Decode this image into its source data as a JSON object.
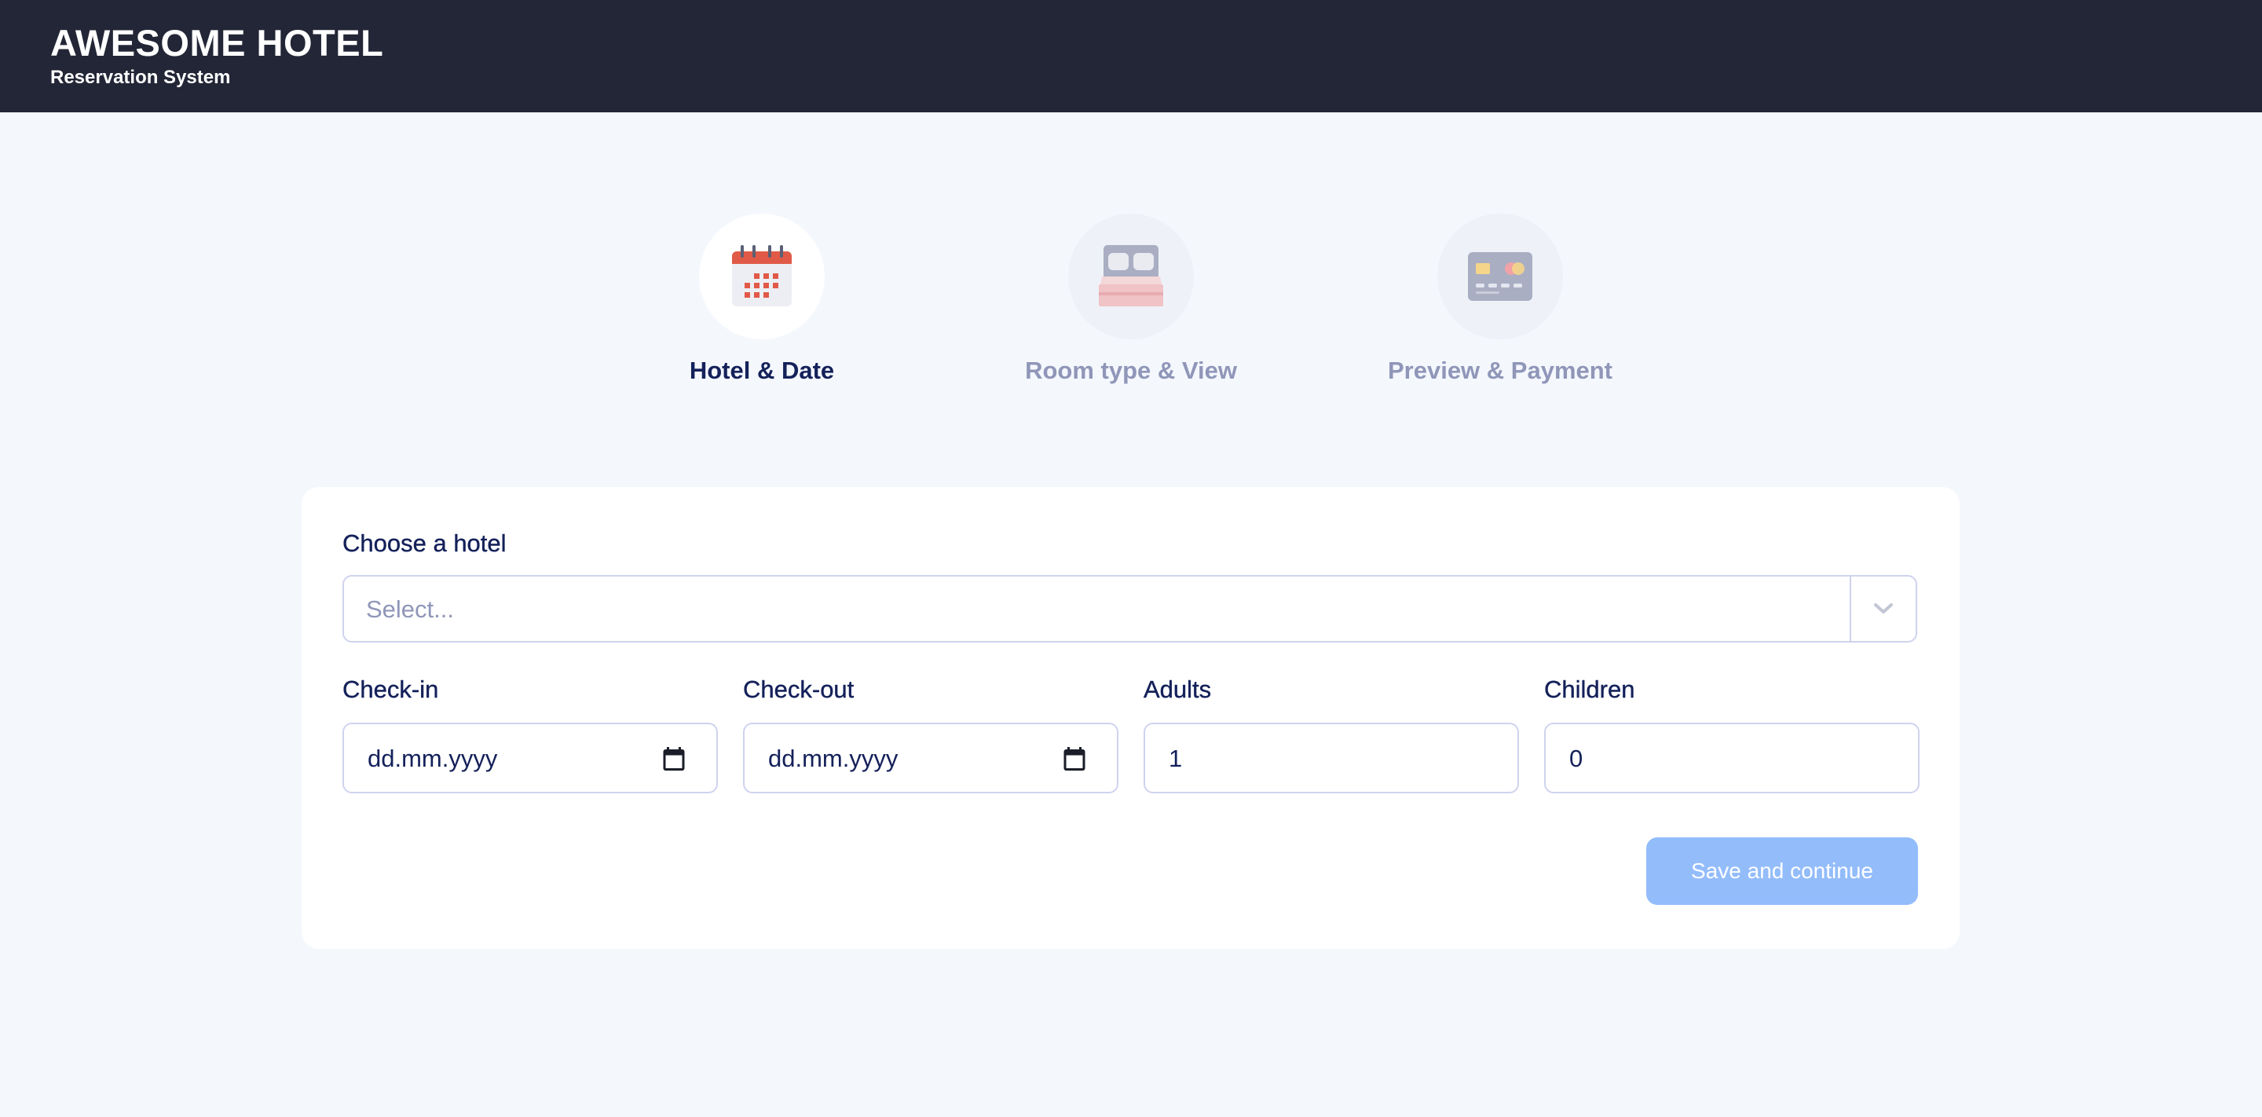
{
  "header": {
    "title": "AWESOME HOTEL",
    "subtitle": "Reservation System",
    "background": "#222636"
  },
  "steps": [
    {
      "label": "Hotel & Date",
      "icon": "calendar-icon",
      "state": "active"
    },
    {
      "label": "Room type & View",
      "icon": "bed-icon",
      "state": "inactive"
    },
    {
      "label": "Preview & Payment",
      "icon": "credit-card-icon",
      "state": "inactive"
    }
  ],
  "form": {
    "hotel": {
      "label": "Choose a hotel",
      "placeholder": "Select...",
      "icon": "chevron-down-icon"
    },
    "check_in": {
      "label": "Check-in",
      "value": "dd.mm.yyyy",
      "icon": "calendar-icon"
    },
    "check_out": {
      "label": "Check-out",
      "value": "dd.mm.yyyy",
      "icon": "calendar-icon"
    },
    "adults": {
      "label": "Adults",
      "value": "1"
    },
    "children": {
      "label": "Children",
      "value": "0"
    },
    "submit_label": "Save and continue"
  },
  "colors": {
    "accent": "#93bcfb",
    "text_primary": "#14215a",
    "text_muted": "#8f96b8",
    "border": "#cfd3ee",
    "page_bg": "#f4f7fc"
  }
}
